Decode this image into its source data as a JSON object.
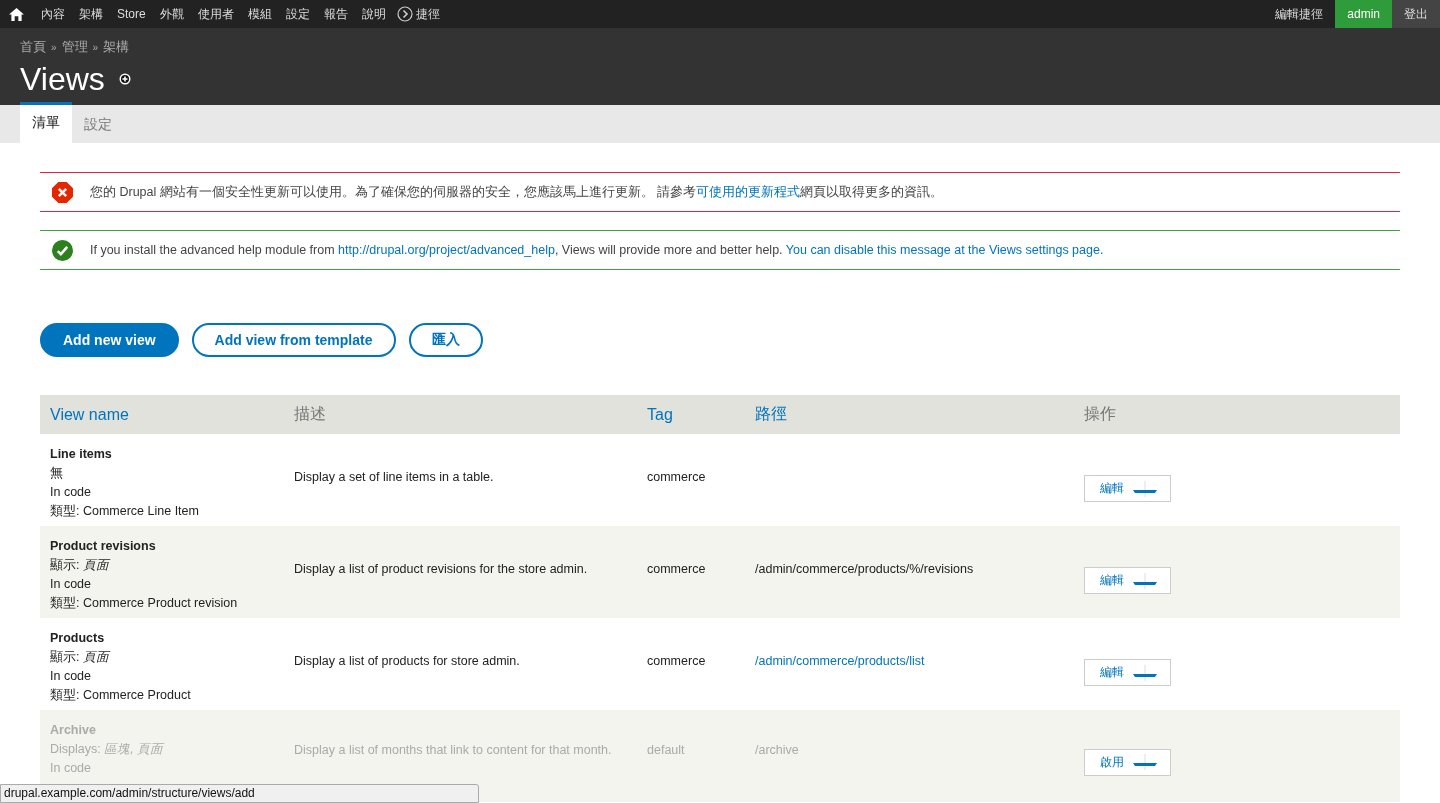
{
  "toolbar": {
    "items": [
      {
        "label": "內容"
      },
      {
        "label": "架構"
      },
      {
        "label": "Store"
      },
      {
        "label": "外觀"
      },
      {
        "label": "使用者"
      },
      {
        "label": "模組"
      },
      {
        "label": "設定"
      },
      {
        "label": "報告"
      },
      {
        "label": "說明"
      }
    ],
    "shortcuts": "捷徑",
    "right": [
      {
        "label": "編輯捷徑",
        "selected": false
      },
      {
        "label": "admin",
        "selected": true
      },
      {
        "label": "登出",
        "selected": false
      }
    ]
  },
  "breadcrumb": {
    "separator": "»",
    "items": [
      "首頁",
      "管理",
      "架構"
    ]
  },
  "title": "Views",
  "tabs": [
    {
      "label": "清單",
      "selected": true
    },
    {
      "label": "設定",
      "selected": false
    }
  ],
  "messages": [
    {
      "kind": "error",
      "parts": [
        {
          "text": "您的 Drupal 網站有一個安全性更新可以使用。為了確保您的伺服器的安全，您應該馬上進行更新。 請參考",
          "link": false
        },
        {
          "text": "可使用的更新程式",
          "link": true
        },
        {
          "text": "網頁以取得更多的資訊。",
          "link": false
        }
      ]
    },
    {
      "kind": "status",
      "parts": [
        {
          "text": "If you install the advanced help module from ",
          "link": false
        },
        {
          "text": "http://drupal.org/project/advanced_help",
          "link": true
        },
        {
          "text": ", Views will provide more and better help. ",
          "link": false
        },
        {
          "text": "You can disable this message at the Views settings page.",
          "link": true
        }
      ]
    }
  ],
  "actions": [
    {
      "label": "Add new view",
      "kind": "primary"
    },
    {
      "label": "Add view from template",
      "kind": "outline"
    },
    {
      "label": "匯入",
      "kind": "outline"
    }
  ],
  "table": {
    "columns": [
      {
        "label": "View name",
        "sortable": true
      },
      {
        "label": "描述",
        "sortable": false
      },
      {
        "label": "Tag",
        "sortable": true
      },
      {
        "label": "路徑",
        "sortable": true
      },
      {
        "label": "操作",
        "sortable": false
      }
    ],
    "rows": [
      {
        "name": "Line items",
        "displays": "無",
        "storage": "In code",
        "type": "類型: Commerce Line Item",
        "description": "Display a set of line items in a table.",
        "tag": "commerce",
        "operation": "編輯",
        "disabled": false
      },
      {
        "name": "Product revisions",
        "displays": "顯示: *頁面*",
        "storage": "In code",
        "type": "類型: Commerce Product revision",
        "description": "Display a list of product revisions for the store admin.",
        "tag": "commerce",
        "path": "/admin/commerce/products/%/revisions",
        "path_link": false,
        "operation": "編輯",
        "disabled": false
      },
      {
        "name": "Products",
        "displays": "顯示: *頁面*",
        "storage": "In code",
        "type": "類型: Commerce Product",
        "description": "Display a list of products for store admin.",
        "tag": "commerce",
        "path": "/admin/commerce/products/list",
        "path_link": true,
        "operation": "編輯",
        "disabled": false
      },
      {
        "name": "Archive",
        "displays": "Displays: *區塊, 頁面*",
        "storage": "In code",
        "description": "Display a list of months that link to content for that month.",
        "tag": "default",
        "path": "/archive",
        "path_link": false,
        "operation": "啟用",
        "disabled": true
      }
    ]
  },
  "status_url": "drupal.example.com/admin/structure/views/add"
}
